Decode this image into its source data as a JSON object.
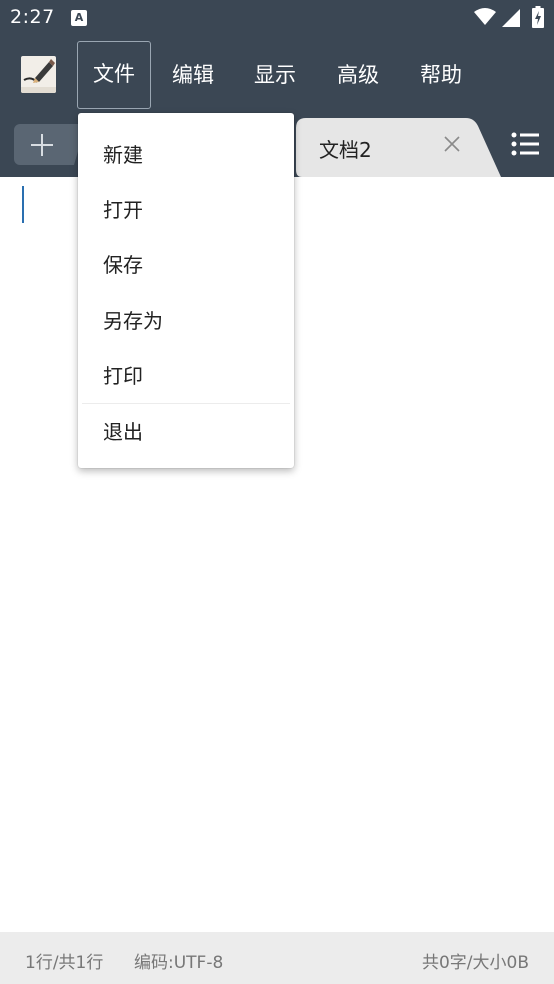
{
  "status_bar": {
    "time": "2:27",
    "notification_icon": "A"
  },
  "menu": {
    "items": [
      {
        "label": "文件"
      },
      {
        "label": "编辑"
      },
      {
        "label": "显示"
      },
      {
        "label": "高级"
      },
      {
        "label": "帮助"
      }
    ],
    "active": "文件"
  },
  "tabs": {
    "open": [
      {
        "label": "文档2"
      }
    ]
  },
  "file_menu": {
    "items": [
      {
        "label": "新建"
      },
      {
        "label": "打开"
      },
      {
        "label": "保存"
      },
      {
        "label": "另存为"
      },
      {
        "label": "打印"
      },
      {
        "label": "退出"
      }
    ]
  },
  "footer": {
    "line_info": "1行/共1行",
    "encoding": "编码:UTF-8",
    "size_info": "共0字/大小0B"
  },
  "colors": {
    "toolbar_bg": "#3b4754",
    "tab_bg": "#e6e6e6",
    "footer_bg": "#ececec",
    "cursor": "#2a6fb0"
  },
  "icons": [
    "notification-a-icon",
    "wifi-icon",
    "signal-icon",
    "battery-icon",
    "app-logo-icon",
    "plus-icon",
    "close-icon",
    "list-icon"
  ]
}
